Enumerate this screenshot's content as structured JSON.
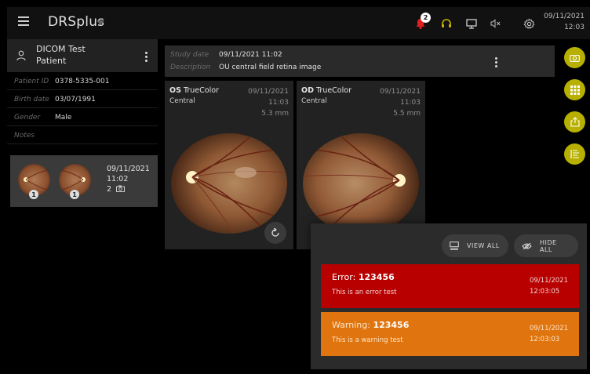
{
  "app": {
    "title": "DRSplus"
  },
  "topbar": {
    "notification_count": "2",
    "date": "09/11/2021",
    "time": "12:03",
    "icons": [
      "menu-icon",
      "caret-down-icon",
      "bell-icon",
      "headset-icon",
      "monitor-icon",
      "speaker-muted-icon",
      "gear-icon"
    ]
  },
  "patient": {
    "name_line1": "DICOM Test",
    "name_line2": "Patient",
    "fields": [
      {
        "label": "Patient ID",
        "value": "0378-5335-001"
      },
      {
        "label": "Birth date",
        "value": "03/07/1991"
      },
      {
        "label": "Gender",
        "value": "Male"
      },
      {
        "label": "Notes",
        "value": ""
      }
    ]
  },
  "study_card": {
    "date": "09/11/2021",
    "time": "11:02",
    "image_count": "2",
    "thumb_badges": [
      "1",
      "1"
    ]
  },
  "study": {
    "date_label": "Study date",
    "date_value": "09/11/2021 11:02",
    "description_label": "Description",
    "description_value": "OU central field retina image"
  },
  "images": [
    {
      "eye": "OS",
      "mode": "TrueColor",
      "field": "Central",
      "date": "09/11/2021",
      "time": "11:03",
      "size": "5.3 mm"
    },
    {
      "eye": "OD",
      "mode": "TrueColor",
      "field": "Central",
      "date": "09/11/2021",
      "time": "11:03",
      "size": "5.5 mm"
    }
  ],
  "fabs": [
    "camera-icon",
    "grid-icon",
    "export-icon",
    "report-icon"
  ],
  "notification_panel": {
    "view_all": "VIEW ALL",
    "hide_all": "HIDE ALL",
    "items": [
      {
        "kind": "Error:",
        "code": "123456",
        "message": "This is an error test",
        "date": "09/11/2021",
        "time": "12:03:05",
        "color": "#b80000"
      },
      {
        "kind": "Warning:",
        "code": "123456",
        "message": "This is a warning test",
        "date": "09/11/2021",
        "time": "12:03:03",
        "color": "#e0740e"
      }
    ]
  },
  "colors": {
    "accent": "#b8b000",
    "background": "#000000",
    "error": "#b80000",
    "warning": "#e0740e"
  }
}
